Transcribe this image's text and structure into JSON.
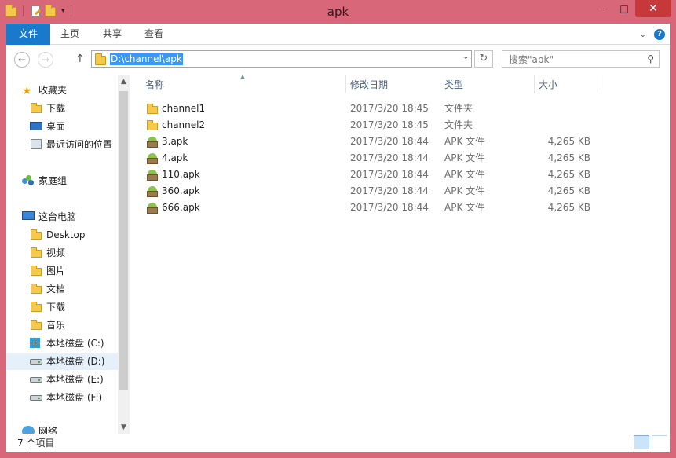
{
  "window": {
    "title": "apk",
    "minimize": "–",
    "maximize": "□",
    "close": "✕"
  },
  "ribbon": {
    "tabs": [
      "文件",
      "主页",
      "共享",
      "查看"
    ],
    "expand": "⌄",
    "help": "?"
  },
  "nav": {
    "back": "←",
    "forward": "→",
    "up": "↑",
    "address": "D:\\channel\\apk",
    "dropdown": "⌄",
    "refresh": "↻",
    "search_placeholder": "搜索\"apk\"",
    "search_icon": "⚲"
  },
  "sidebar": {
    "items": [
      {
        "label": "收藏夹",
        "icon": "star-icon"
      },
      {
        "label": "下载",
        "icon": "downloads-folder-icon"
      },
      {
        "label": "桌面",
        "icon": "desktop-icon"
      },
      {
        "label": "最近访问的位置",
        "icon": "recent-places-icon"
      },
      {
        "label": "家庭组",
        "icon": "homegroup-icon"
      },
      {
        "label": "这台电脑",
        "icon": "computer-icon"
      },
      {
        "label": "Desktop",
        "icon": "folder-icon"
      },
      {
        "label": "视频",
        "icon": "videos-folder-icon"
      },
      {
        "label": "图片",
        "icon": "pictures-folder-icon"
      },
      {
        "label": "文档",
        "icon": "documents-folder-icon"
      },
      {
        "label": "下载",
        "icon": "downloads-folder-icon"
      },
      {
        "label": "音乐",
        "icon": "music-folder-icon"
      },
      {
        "label": "本地磁盘 (C:)",
        "icon": "system-drive-icon"
      },
      {
        "label": "本地磁盘 (D:)",
        "icon": "drive-icon"
      },
      {
        "label": "本地磁盘 (E:)",
        "icon": "drive-icon"
      },
      {
        "label": "本地磁盘 (F:)",
        "icon": "drive-icon"
      },
      {
        "label": "网络",
        "icon": "network-icon"
      }
    ],
    "selected": "本地磁盘 (D:)",
    "scroll_up": "▲",
    "scroll_down": "▼"
  },
  "columns": {
    "name": "名称",
    "date": "修改日期",
    "type": "类型",
    "size": "大小",
    "sort_indicator": "▲"
  },
  "files": [
    {
      "name": "channel1",
      "date": "2017/3/20 18:45",
      "type": "文件夹",
      "size": "",
      "icon": "folder-icon"
    },
    {
      "name": "channel2",
      "date": "2017/3/20 18:45",
      "type": "文件夹",
      "size": "",
      "icon": "folder-icon"
    },
    {
      "name": "3.apk",
      "date": "2017/3/20 18:44",
      "type": "APK 文件",
      "size": "4,265 KB",
      "icon": "apk-file-icon"
    },
    {
      "name": "4.apk",
      "date": "2017/3/20 18:44",
      "type": "APK 文件",
      "size": "4,265 KB",
      "icon": "apk-file-icon"
    },
    {
      "name": "110.apk",
      "date": "2017/3/20 18:44",
      "type": "APK 文件",
      "size": "4,265 KB",
      "icon": "apk-file-icon"
    },
    {
      "name": "360.apk",
      "date": "2017/3/20 18:44",
      "type": "APK 文件",
      "size": "4,265 KB",
      "icon": "apk-file-icon"
    },
    {
      "name": "666.apk",
      "date": "2017/3/20 18:44",
      "type": "APK 文件",
      "size": "4,265 KB",
      "icon": "apk-file-icon"
    }
  ],
  "status": {
    "count": "7 个项目"
  },
  "colors": {
    "frame": "#d8677a",
    "file_tab": "#1979ca",
    "selection": "#3399ff",
    "close_button": "#c7383b"
  }
}
